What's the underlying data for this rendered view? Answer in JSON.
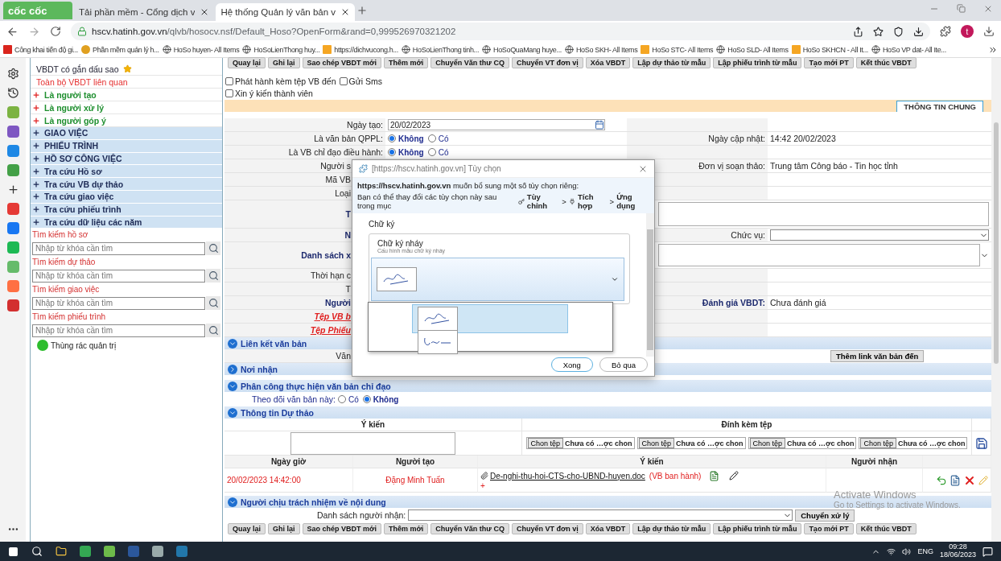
{
  "browser": {
    "logo": "cốc cốc",
    "tabs": [
      {
        "title": "Tải phần mềm - Cổng dịch v",
        "selected": false
      },
      {
        "title": "Hệ thống Quản lý văn bản v",
        "selected": true
      }
    ],
    "url_host": "hscv.hatinh.gov.vn",
    "url_path": "/qlvb/hosocv.nsf/Default_Hoso?OpenForm&rand=0,999526970321202",
    "profile_initial": "t",
    "bookmarks": [
      {
        "label": "Công khai tiến độ gi...",
        "kind": "flag"
      },
      {
        "label": "Phần mềm quản lý h...",
        "kind": "emblem"
      },
      {
        "label": "HoSo huyen- All Items",
        "kind": "globe"
      },
      {
        "label": "HoSoLienThong huy...",
        "kind": "globe"
      },
      {
        "label": "https://dichvucong.h...",
        "kind": "app"
      },
      {
        "label": "HoSoLienThong tinh...",
        "kind": "globe"
      },
      {
        "label": "HoSoQuaMang huye...",
        "kind": "globe"
      },
      {
        "label": "HoSo SKH- All Items",
        "kind": "globe"
      },
      {
        "label": "HoSo STC- All Items",
        "kind": "app"
      },
      {
        "label": "HoSo SLD- All Items",
        "kind": "globe"
      },
      {
        "label": "HoSo SKHCN - All It...",
        "kind": "app"
      },
      {
        "label": "HoSo VP dat- All Ite...",
        "kind": "globe"
      }
    ]
  },
  "sidebar": {
    "items": [
      {
        "label": "VBDT có gắn dấu sao",
        "kind": "starred"
      },
      {
        "label": "Toàn bộ VBDT liên quan",
        "kind": "related"
      },
      {
        "label": "Là người tạo",
        "kind": "role",
        "expanded": false
      },
      {
        "label": "Là người xử lý",
        "kind": "role",
        "expanded": false
      },
      {
        "label": "Là người góp ý",
        "kind": "role",
        "expanded": false
      }
    ],
    "groups": [
      {
        "label": "GIAO VIỆC",
        "expanded": false
      },
      {
        "label": "PHIẾU TRÌNH",
        "expanded": false
      },
      {
        "label": "HỒ SƠ CÔNG VIỆC",
        "expanded": false
      },
      {
        "label": "Tra cứu Hồ sơ",
        "expanded": false
      },
      {
        "label": "Tra cứu VB dự thảo",
        "expanded": false
      },
      {
        "label": "Tra cứu giao việc",
        "expanded": false
      },
      {
        "label": "Tra cứu phiếu trình",
        "expanded": false
      },
      {
        "label": "Tra cứu dữ liệu các năm",
        "expanded": false
      }
    ],
    "searches": [
      {
        "label": "Tìm kiếm hồ sơ",
        "placeholder": "Nhập từ khóa cần tìm"
      },
      {
        "label": "Tìm kiếm dự thảo",
        "placeholder": "Nhập từ khóa cần tìm"
      },
      {
        "label": "Tìm kiếm giao việc",
        "placeholder": "Nhập từ khóa cần tìm"
      },
      {
        "label": "Tìm kiếm phiếu trình",
        "placeholder": "Nhập từ khóa cần tìm"
      }
    ],
    "trash": "Thùng rác quản trị"
  },
  "toolbar_top": [
    "Quay lại",
    "Ghi lại",
    "Sao chép VBDT mới",
    "Thêm mới",
    "Chuyển Văn thư CQ",
    "Chuyển VT đơn vị",
    "Xóa VBDT",
    "Lập dự thảo từ mẫu",
    "Lập phiếu trình từ mẫu",
    "Tạo mới PT",
    "Kết thúc VBDT"
  ],
  "options": [
    [
      {
        "label": "Phát hành kèm tệp VB đến",
        "checked": false
      },
      {
        "label": "Gửi Sms",
        "checked": false
      }
    ],
    [
      {
        "label": "Xin ý kiến thành viên",
        "checked": false
      }
    ]
  ],
  "tab": {
    "label": "THÔNG TIN CHUNG",
    "selected": true
  },
  "form": [
    {
      "label": "Ngày tạo:",
      "kind": "plain",
      "covered": false,
      "field": {
        "kind": "date",
        "value": "20/02/2023"
      }
    },
    {
      "label": "Là văn bản QPPL:",
      "kind": "plain",
      "covered": false,
      "field": {
        "kind": "radio",
        "options": [
          {
            "label": "Không",
            "selected": true
          },
          {
            "label": "Có",
            "selected": false
          }
        ]
      },
      "right": {
        "kind": "text",
        "label": "Ngày cập nhật:",
        "bold": false,
        "value": "14:42 20/02/2023"
      }
    },
    {
      "label": "Là VB chỉ đạo điều hành:",
      "kind": "plain",
      "covered": false,
      "field": {
        "kind": "radio",
        "options": [
          {
            "label": "Không",
            "selected": true
          },
          {
            "label": "Có",
            "selected": false
          }
        ]
      }
    },
    {
      "label": "Người s",
      "kind": "plain",
      "covered": true,
      "right": {
        "kind": "text",
        "label": "Đơn vị soạn thảo:",
        "bold": false,
        "value": "Trung tâm Công báo - Tin học tỉnh"
      }
    },
    {
      "label": "Mã VB",
      "kind": "plain",
      "covered": true
    },
    {
      "label": "Loại",
      "kind": "plain",
      "covered": true
    },
    {
      "label": "T",
      "kind": "bold",
      "covered": true,
      "right": {
        "kind": "textarea"
      }
    },
    {
      "label": "N",
      "kind": "bold",
      "covered": true,
      "right": {
        "kind": "select",
        "label": "Chức vụ:"
      }
    },
    {
      "label": "Danh sách x",
      "kind": "bold",
      "covered": true,
      "right": {
        "kind": "textarea_select"
      }
    },
    {
      "label": "Thời hạn c",
      "kind": "plain",
      "covered": true
    },
    {
      "label": "T",
      "kind": "plain",
      "covered": true
    },
    {
      "label": "Người",
      "kind": "bold",
      "covered": true,
      "right": {
        "kind": "text",
        "label": "Đánh giá VBDT:",
        "bold": true,
        "value": "Chưa đánh giá"
      }
    },
    {
      "label": "Tệp VB b",
      "kind": "file",
      "covered": true
    },
    {
      "label": "Tệp Phiếu",
      "kind": "file",
      "covered": true
    }
  ],
  "link_section": {
    "title": "Liên kết văn bản",
    "expanded": true,
    "label": "Văn",
    "covered": true,
    "button": "Thêm link văn bản đến"
  },
  "recipients_section": {
    "title": "Nơi nhận",
    "expanded": false
  },
  "assignment_section": {
    "title": "Phân công thực hiện văn bản chỉ đạo",
    "expanded": true,
    "follow_label": "Theo dõi văn bản này:",
    "options": [
      {
        "label": "Có",
        "selected": false
      },
      {
        "label": "Không",
        "selected": true
      }
    ]
  },
  "draft_section": {
    "title": "Thông tin Dự thảo",
    "expanded": true,
    "columns": [
      "Ý kiến",
      "Đính kèm tệp"
    ],
    "files": [
      {
        "button": "Chon tệp",
        "status": "Chưa có …ợc chon"
      },
      {
        "button": "Chon tệp",
        "status": "Chưa có …ợc chon"
      },
      {
        "button": "Chon tệp",
        "status": "Chưa có …ợc chon"
      },
      {
        "button": "Chon tệp",
        "status": "Chưa có …ợc chon"
      }
    ],
    "history_columns": [
      "Ngày giờ",
      "Người tạo",
      "Ý kiến",
      "Người nhận"
    ],
    "history": [
      {
        "time": "20/02/2023 14:42:00",
        "creator": "Đặng Minh Tuấn",
        "file": "De-nghi-thu-hoi-CTS-cho-UBND-huyen.doc",
        "tag": "(VB ban hành)",
        "mark": "+"
      }
    ]
  },
  "responsible_section": {
    "title": "Người chịu trách nhiệm về nội dung",
    "expanded": true,
    "label": "Danh sách người nhận:",
    "button": "Chuyển xử lý"
  },
  "toolbar_bottom": [
    "Quay lại",
    "Ghi lại",
    "Sao chép VBDT mới",
    "Thêm mới",
    "Chuyển Văn thư CQ",
    "Chuyển VT đơn vị",
    "Xóa VBDT",
    "Lập dự thảo từ mẫu",
    "Lập phiếu trình từ mẫu",
    "Tạo mới PT",
    "Kết thúc VBDT"
  ],
  "dialog": {
    "title": "[https://hscv.hatinh.gov.vn] Tùy chọn",
    "message": "**https://hscv.hatinh.gov.vn**  muốn bổ sung một số tùy chọn riêng:",
    "hint": "Bạn có thể thay đổi các tùy chọn này sau trong mục",
    "path": [
      "Tùy chỉnh",
      "Tích hợp",
      "Ứng dụng"
    ],
    "separator": ">",
    "group": "Chữ ký",
    "card_title": "Chữ ký nháy",
    "card_subtitle": "Cấu hình mẫu chữ ký nháy",
    "open": true,
    "options": [
      {
        "selected": true
      },
      {
        "selected": false
      }
    ],
    "buttons": [
      {
        "label": "Xong",
        "kind": "primary"
      },
      {
        "label": "Bỏ qua",
        "kind": "secondary"
      }
    ]
  },
  "os": {
    "watermark_title": "Activate Windows",
    "watermark_text": "Go to Settings to activate Windows.",
    "lang": "ENG",
    "time": "09:28",
    "date": "18/06/2023"
  }
}
